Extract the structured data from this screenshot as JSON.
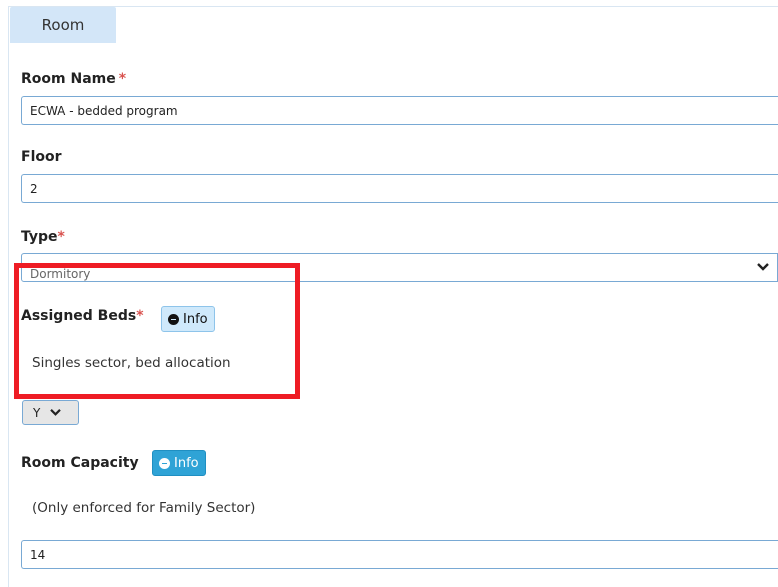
{
  "tab": {
    "label": "Room"
  },
  "room_name": {
    "label": "Room Name",
    "required": "*",
    "value": "ECWA - bedded program"
  },
  "floor": {
    "label": "Floor",
    "value": "2"
  },
  "type": {
    "label": "Type",
    "required": "*",
    "value": "Dormitory"
  },
  "assigned_beds": {
    "label": "Assigned Beds",
    "required": "*",
    "info_label": "Info",
    "note": "Singles sector, bed allocation",
    "select_value": "Y"
  },
  "room_capacity": {
    "label": "Room Capacity",
    "info_label": "Info",
    "note": "(Only enforced for Family Sector)",
    "value": "14"
  },
  "colors": {
    "accent": "#2fa3d6",
    "tab": "#d3e6f8",
    "highlight": "#ee1c24",
    "required": "#d9534f"
  },
  "icons": {
    "info": "minus-circle-icon",
    "dropdown": "chevron-down-icon"
  }
}
